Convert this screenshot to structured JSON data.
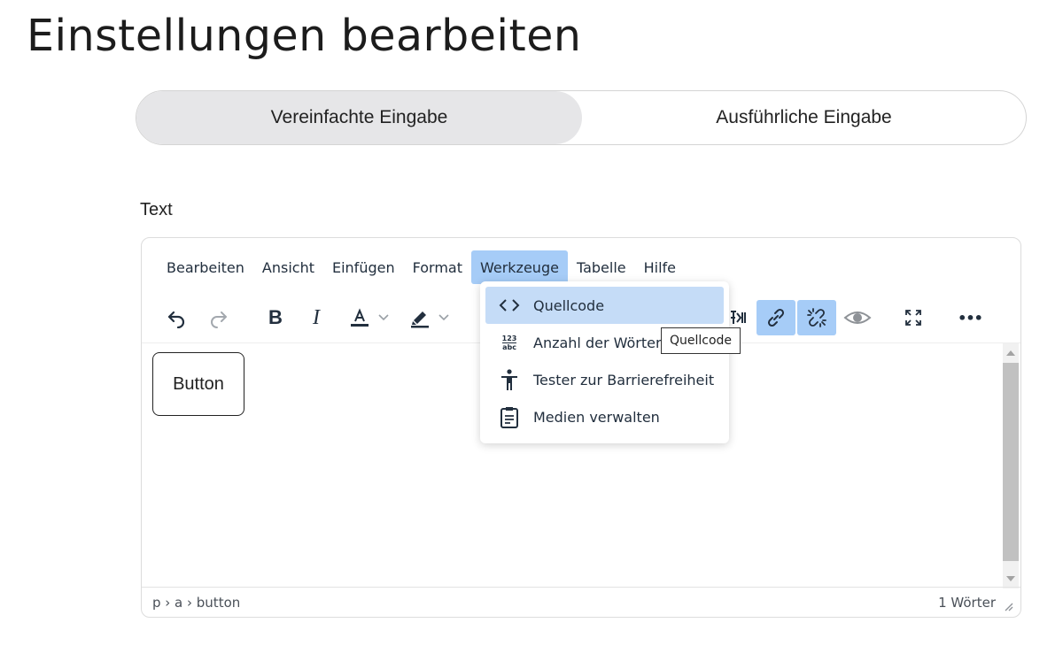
{
  "page": {
    "title": "Einstellungen bearbeiten"
  },
  "mode_toggle": {
    "simple": "Vereinfachte Eingabe",
    "detailed": "Ausführliche Eingabe",
    "selected": "simple"
  },
  "field": {
    "label": "Text"
  },
  "editor": {
    "menubar": [
      "Bearbeiten",
      "Ansicht",
      "Einfügen",
      "Format",
      "Werkzeuge",
      "Tabelle",
      "Hilfe"
    ],
    "active_menu": "Werkzeuge",
    "toolbar": {
      "icons": [
        "undo-icon",
        "redo-icon",
        "bold-icon",
        "italic-icon",
        "text-color-icon",
        "highlight-icon",
        "text-direction-icon",
        "link-icon",
        "unlink-icon",
        "preview-icon",
        "fullscreen-icon",
        "more-icon"
      ],
      "bold": "B",
      "italic": "I",
      "more": "•••"
    },
    "content": {
      "button_text": "Button"
    },
    "statusbar": {
      "path": "p › a › button",
      "word_count": "1 Wörter"
    }
  },
  "tools_menu": {
    "items": [
      {
        "label": "Quellcode",
        "icon": "source-code-icon"
      },
      {
        "label": "Anzahl der Wörter",
        "icon": "word-count-icon",
        "icon_text": "123\nabc"
      },
      {
        "label": "Tester zur Barrierefreiheit",
        "icon": "accessibility-icon"
      },
      {
        "label": "Medien verwalten",
        "icon": "media-manage-icon"
      }
    ],
    "highlighted_index": 0
  },
  "tooltip": {
    "text": "Quellcode"
  },
  "colors": {
    "accent": "#a6ccf7",
    "menu_hover": "#c5dcf7",
    "toggle_active": "#e6e6e8"
  }
}
